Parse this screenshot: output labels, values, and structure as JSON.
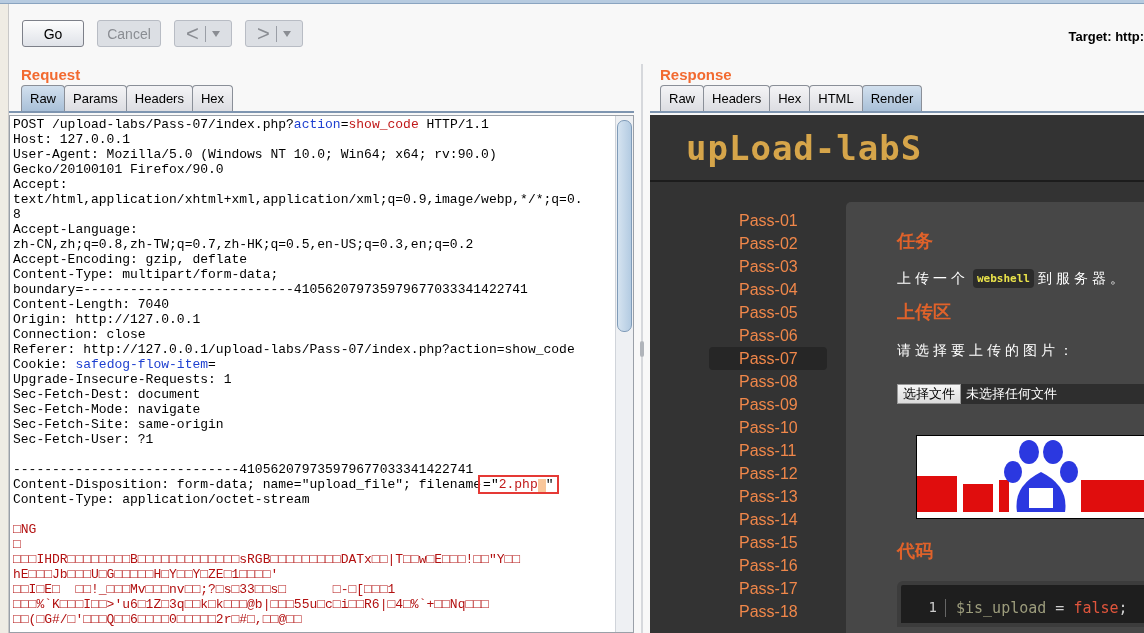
{
  "toolbar": {
    "buttons": [
      {
        "kind": "text",
        "label": "Go",
        "disabled": false
      },
      {
        "kind": "text",
        "label": "Cancel",
        "disabled": true
      },
      {
        "kind": "history",
        "label": "<",
        "disabled": true
      },
      {
        "kind": "history",
        "label": ">",
        "disabled": true
      }
    ],
    "target": "Target: http:"
  },
  "request": {
    "title": "Request",
    "tabs": [
      {
        "label": "Raw",
        "selected": true
      },
      {
        "label": "Params",
        "selected": false
      },
      {
        "label": "Headers",
        "selected": false
      },
      {
        "label": "Hex",
        "selected": false
      }
    ],
    "lines": [
      {
        "kind": "mixed",
        "segments": [
          {
            "kind": "plain",
            "text": "POST /upload-labs/Pass-07/index.php?"
          },
          {
            "kind": "name",
            "text": "action"
          },
          {
            "kind": "plain",
            "text": "="
          },
          {
            "kind": "value",
            "text": "show_code"
          },
          {
            "kind": "plain",
            "text": " HTTP/1.1"
          }
        ]
      },
      {
        "kind": "plain",
        "text": "Host: 127.0.0.1"
      },
      {
        "kind": "plain",
        "text": "User-Agent: Mozilla/5.0 (Windows NT 10.0; Win64; x64; rv:90.0)"
      },
      {
        "kind": "plain",
        "text": "Gecko/20100101 Firefox/90.0"
      },
      {
        "kind": "plain",
        "text": "Accept:"
      },
      {
        "kind": "plain",
        "text": "text/html,application/xhtml+xml,application/xml;q=0.9,image/webp,*/*;q=0."
      },
      {
        "kind": "plain",
        "text": "8"
      },
      {
        "kind": "plain",
        "text": "Accept-Language:"
      },
      {
        "kind": "plain",
        "text": "zh-CN,zh;q=0.8,zh-TW;q=0.7,zh-HK;q=0.5,en-US;q=0.3,en;q=0.2"
      },
      {
        "kind": "plain",
        "text": "Accept-Encoding: gzip, deflate"
      },
      {
        "kind": "plain",
        "text": "Content-Type: multipart/form-data;"
      },
      {
        "kind": "plain",
        "text": "boundary=---------------------------410562079735979677033341422741"
      },
      {
        "kind": "plain",
        "text": "Content-Length: 7040"
      },
      {
        "kind": "plain",
        "text": "Origin: http://127.0.0.1"
      },
      {
        "kind": "plain",
        "text": "Connection: close"
      },
      {
        "kind": "plain",
        "text": "Referer: http://127.0.0.1/upload-labs/Pass-07/index.php?action=show_code"
      },
      {
        "kind": "mixed",
        "segments": [
          {
            "kind": "plain",
            "text": "Cookie: "
          },
          {
            "kind": "name",
            "text": "safedog-flow-item"
          },
          {
            "kind": "plain",
            "text": "="
          }
        ]
      },
      {
        "kind": "plain",
        "text": "Upgrade-Insecure-Requests: 1"
      },
      {
        "kind": "plain",
        "text": "Sec-Fetch-Dest: document"
      },
      {
        "kind": "plain",
        "text": "Sec-Fetch-Mode: navigate"
      },
      {
        "kind": "plain",
        "text": "Sec-Fetch-Site: same-origin"
      },
      {
        "kind": "plain",
        "text": "Sec-Fetch-User: ?1"
      },
      {
        "kind": "blank"
      },
      {
        "kind": "plain",
        "text": "-----------------------------410562079735979677033341422741"
      },
      {
        "kind": "mixed",
        "segments": [
          {
            "kind": "plain",
            "text": "Content-Disposition: form-data; name=\"upload_file\"; filename"
          },
          {
            "kind": "boxed",
            "segments": [
              {
                "kind": "plain",
                "text": "=\""
              },
              {
                "kind": "value",
                "text": "2.php"
              },
              {
                "kind": "selection"
              },
              {
                "kind": "plain",
                "text": "\""
              }
            ]
          }
        ]
      },
      {
        "kind": "plain",
        "text": "Content-Type: application/octet-stream"
      },
      {
        "kind": "blank"
      },
      {
        "kind": "binary",
        "text": "□NG"
      },
      {
        "kind": "binary",
        "text": "□"
      },
      {
        "kind": "binary",
        "text": "□□□IHDR□□□□□□□□B□□□□□□□□□□□□□sRGB□□□□□□□□□DATx□□|T□□w□E□□□!□□\"Y□□"
      },
      {
        "kind": "binary",
        "text": "hE□□□Jb□□□U□G□□□□□H□Y□□Y□ZE□1□□□□'"
      },
      {
        "kind": "binary",
        "text": "□□I□E□  □□!_□□□Mv□□□nv□□;?□s□33□□s□      □-□[□□□1"
      },
      {
        "kind": "binary",
        "text": "□□□%`K□□□I□□>'u6□1Z□3q□□k□k□□□@b|□□□55u□c□i□□R6|□4□%`+□□Nq□□□"
      },
      {
        "kind": "binary",
        "text": "□□(□G#/□'□□□Q□□6□□□□0□□□□□2r□#□,□□@□□"
      }
    ]
  },
  "response": {
    "title": "Response",
    "tabs": [
      {
        "label": "Raw",
        "selected": false
      },
      {
        "label": "Headers",
        "selected": false
      },
      {
        "label": "Hex",
        "selected": false
      },
      {
        "label": "HTML",
        "selected": false
      },
      {
        "label": "Render",
        "selected": true
      }
    ],
    "render": {
      "logo": "upLoad-labS",
      "nav": [
        {
          "label": "Pass-01",
          "selected": false
        },
        {
          "label": "Pass-02",
          "selected": false
        },
        {
          "label": "Pass-03",
          "selected": false
        },
        {
          "label": "Pass-04",
          "selected": false
        },
        {
          "label": "Pass-05",
          "selected": false
        },
        {
          "label": "Pass-06",
          "selected": false
        },
        {
          "label": "Pass-07",
          "selected": true
        },
        {
          "label": "Pass-08",
          "selected": false
        },
        {
          "label": "Pass-09",
          "selected": false
        },
        {
          "label": "Pass-10",
          "selected": false
        },
        {
          "label": "Pass-11",
          "selected": false
        },
        {
          "label": "Pass-12",
          "selected": false
        },
        {
          "label": "Pass-13",
          "selected": false
        },
        {
          "label": "Pass-14",
          "selected": false
        },
        {
          "label": "Pass-15",
          "selected": false
        },
        {
          "label": "Pass-16",
          "selected": false
        },
        {
          "label": "Pass-17",
          "selected": false
        },
        {
          "label": "Pass-18",
          "selected": false
        }
      ],
      "task_heading": "任务",
      "task": {
        "before": "上传一个",
        "code": "webshell",
        "after": "到服务器。"
      },
      "upload_heading": "上传区",
      "prompt": "请选择要上传的图片：",
      "file_button": "选择文件",
      "file_status": "未选择任何文件",
      "code_heading": "代码",
      "code_lines": [
        {
          "number": "1",
          "segments": [
            {
              "kind": "variable",
              "text": "$is_upload"
            },
            {
              "kind": "operator",
              "text": " = "
            },
            {
              "kind": "keyword",
              "text": "false"
            },
            {
              "kind": "operator",
              "text": ";"
            }
          ]
        }
      ]
    }
  }
}
